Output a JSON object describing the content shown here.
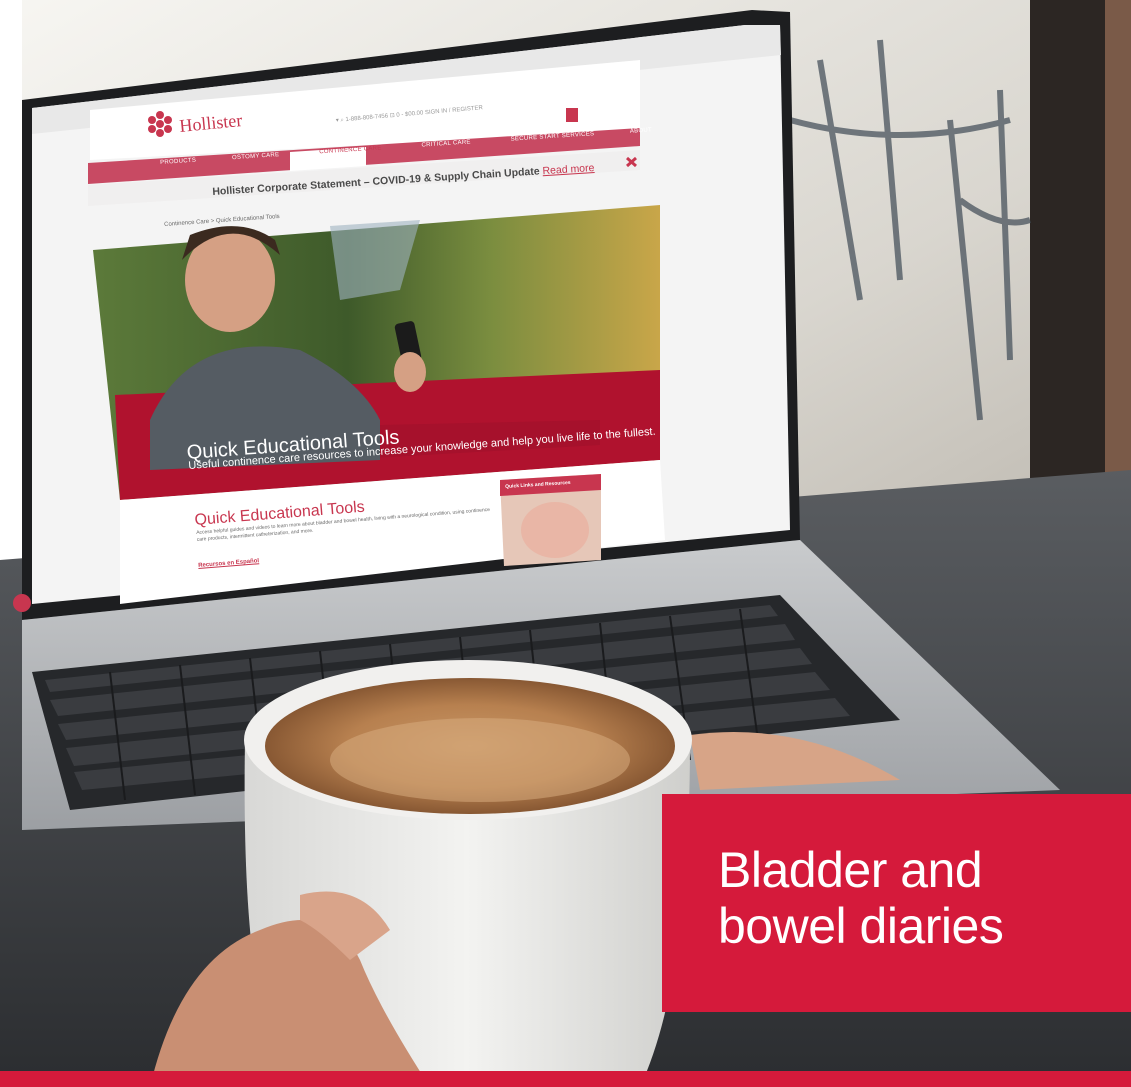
{
  "photo": {
    "website": {
      "logo": "Hollister",
      "nav_tabs": [
        "PRODUCTS",
        "OSTOMY CARE",
        "CONTINENCE CARE",
        "CRITICAL CARE",
        "SECURE START SERVICES",
        "ABOUT"
      ],
      "announcement": {
        "text": "Hollister Corporate Statement – COVID-19 & Supply Chain Update",
        "link": "Read more"
      },
      "breadcrumb": [
        "Continence Care",
        "Quick Educational Tools"
      ],
      "hero": {
        "title": "Quick Educational Tools",
        "subtitle": "Useful continence care resources to increase your knowledge and help you live life to the fullest."
      },
      "section_title": "Quick Educational Tools",
      "section_body": "Access helpful guides and videos to learn more about bladder and bowel health, living with a neurological condition, using continence care products, intermittent catheterization, and more.",
      "spanish_link": "Recursos en Español",
      "sidebar_card_title": "Quick Links and Resources"
    }
  },
  "card": {
    "title": "Bladder and bowel diaries"
  },
  "colors": {
    "brand_red": "#d51a3b",
    "text_on_red": "#ffffff"
  }
}
